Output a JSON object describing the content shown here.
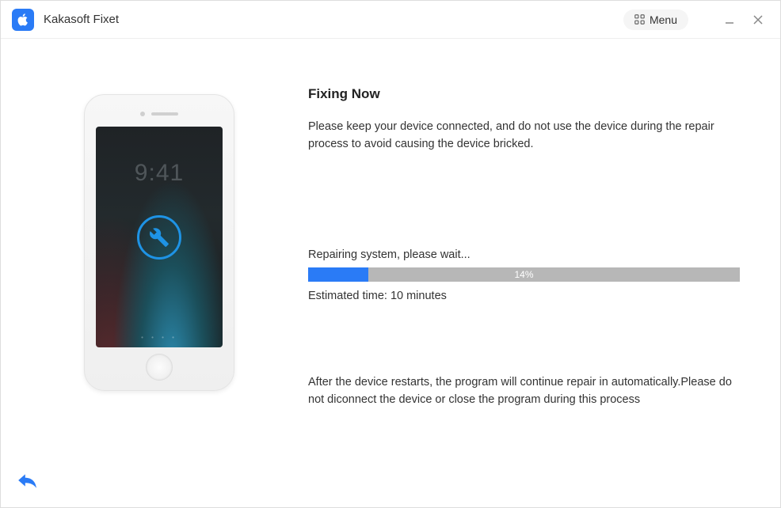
{
  "app": {
    "title": "Kakasoft Fixet",
    "menu_label": "Menu"
  },
  "icons": {
    "app_logo": "apple-icon",
    "menu_grid": "menu-grid-icon",
    "minimize": "minimize-icon",
    "close": "close-icon",
    "wrench": "wrench-icon",
    "back": "back-arrow-icon"
  },
  "device": {
    "lockscreen_time": "9:41"
  },
  "main": {
    "heading": "Fixing Now",
    "description": "Please keep your device connected, and do not use the device during the repair process to avoid causing the device bricked.",
    "status_text": "Repairing system, please wait...",
    "progress_percent": 14,
    "progress_label": "14%",
    "estimated_label": "Estimated time: 10 minutes",
    "footer_note": "After the device restarts, the program will continue repair in automatically.Please do not diconnect the device or close the program during this process"
  },
  "colors": {
    "accent": "#2a7bf6",
    "progress_track": "#b7b7b7"
  }
}
